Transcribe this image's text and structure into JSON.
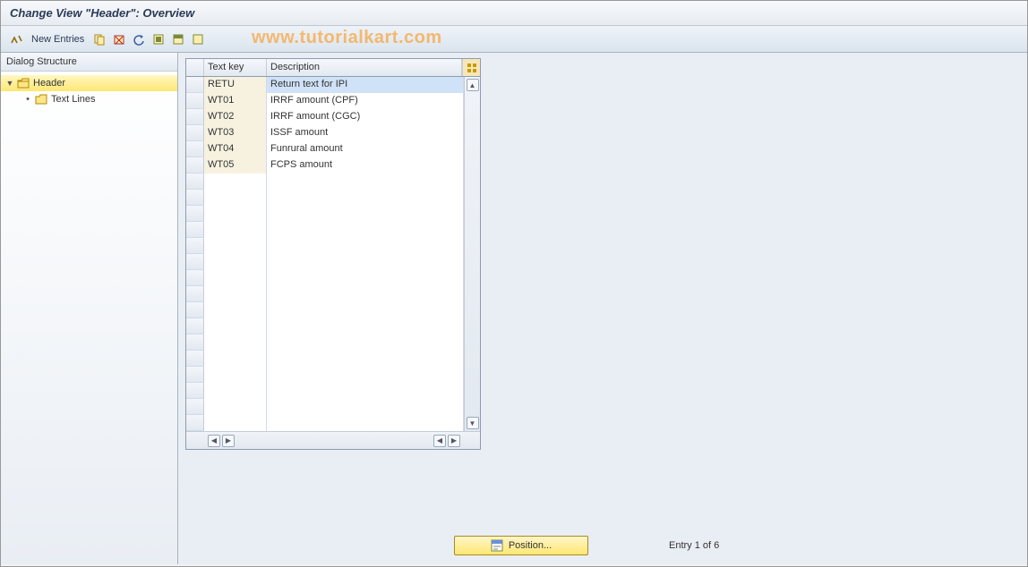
{
  "title": "Change View \"Header\": Overview",
  "toolbar": {
    "new_entries": "New Entries"
  },
  "watermark": "www.tutorialkart.com",
  "dialog_structure": {
    "header_label": "Dialog Structure",
    "nodes": {
      "root": "Header",
      "child": "Text Lines"
    }
  },
  "grid": {
    "columns": {
      "key": "Text key",
      "desc": "Description"
    },
    "rows": [
      {
        "key": "RETU",
        "desc": "Return text for IPI",
        "highlight": true
      },
      {
        "key": "WT01",
        "desc": "IRRF amount (CPF)"
      },
      {
        "key": "WT02",
        "desc": "IRRF amount (CGC)"
      },
      {
        "key": "WT03",
        "desc": "ISSF amount"
      },
      {
        "key": "WT04",
        "desc": "Funrural amount"
      },
      {
        "key": "WT05",
        "desc": "FCPS amount"
      }
    ],
    "empty_rows": 16
  },
  "footer": {
    "position_btn": "Position...",
    "entry_status": "Entry 1 of 6"
  }
}
